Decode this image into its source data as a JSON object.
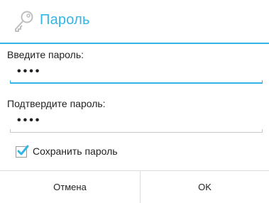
{
  "dialog": {
    "title": "Пароль",
    "icon": "key-icon",
    "accent_color": "#33b5e5"
  },
  "password_field": {
    "label": "Введите пароль:",
    "value": "••••"
  },
  "confirm_field": {
    "label": "Подтвердите пароль:",
    "value": "••••"
  },
  "save_password": {
    "label": "Сохранить пароль",
    "checked": true
  },
  "buttons": {
    "cancel_label": "Отмена",
    "ok_label": "OK"
  }
}
